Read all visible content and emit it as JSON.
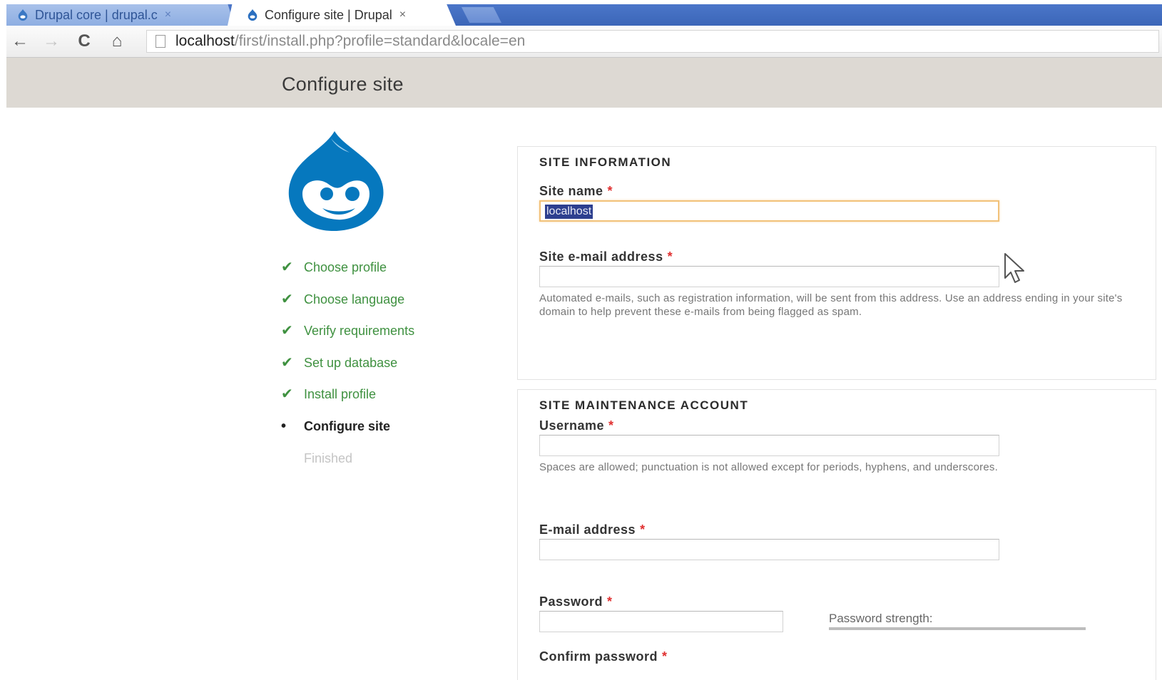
{
  "browser": {
    "tabs": [
      {
        "label": "Drupal core | drupal.c",
        "close": "×",
        "active": false
      },
      {
        "label": "Configure site | Drupal",
        "close": "×",
        "active": true
      }
    ],
    "nav": {
      "back": "←",
      "forward": "→",
      "reload": "C",
      "home": "⌂"
    },
    "address": {
      "host": "localhost",
      "path": "/first/install.php?profile=standard&locale=en"
    }
  },
  "header": {
    "title": "Configure site"
  },
  "steps": [
    {
      "label": "Choose profile",
      "status": "done",
      "marker": "✔"
    },
    {
      "label": "Choose language",
      "status": "done",
      "marker": "✔"
    },
    {
      "label": "Verify requirements",
      "status": "done",
      "marker": "✔"
    },
    {
      "label": "Set up database",
      "status": "done",
      "marker": "✔"
    },
    {
      "label": "Install profile",
      "status": "done",
      "marker": "✔"
    },
    {
      "label": "Configure site",
      "status": "current",
      "marker": "•"
    },
    {
      "label": "Finished",
      "status": "pending",
      "marker": ""
    }
  ],
  "site_information": {
    "legend": "SITE INFORMATION",
    "site_name": {
      "label": "Site name",
      "required": "*",
      "value": "localhost"
    },
    "site_email": {
      "label": "Site e-mail address",
      "required": "*",
      "value": "",
      "help": "Automated e-mails, such as registration information, will be sent from this address. Use an address ending in your site's domain to help prevent these e-mails from being flagged as spam."
    }
  },
  "maintenance_account": {
    "legend": "SITE MAINTENANCE ACCOUNT",
    "username": {
      "label": "Username",
      "required": "*",
      "value": "",
      "help": "Spaces are allowed; punctuation is not allowed except for periods, hyphens, and underscores."
    },
    "email": {
      "label": "E-mail address",
      "required": "*",
      "value": ""
    },
    "password": {
      "label": "Password",
      "required": "*",
      "value": "",
      "strength_label": "Password strength:"
    },
    "confirm_password": {
      "label": "Confirm password",
      "required": "*"
    }
  },
  "colors": {
    "tab_strip": "#3b66b8",
    "header_band": "#ddd9d3",
    "step_done": "#3f9140",
    "required": "#e03030",
    "drupal_blue": "#0678be",
    "focus_border": "#f2c27a",
    "selection": "#2d3f8f"
  },
  "icons": {
    "favicon": "drupal-drop-icon",
    "logo": "drupal-logo",
    "page": "page-icon",
    "cursor": "mouse-pointer-icon"
  }
}
